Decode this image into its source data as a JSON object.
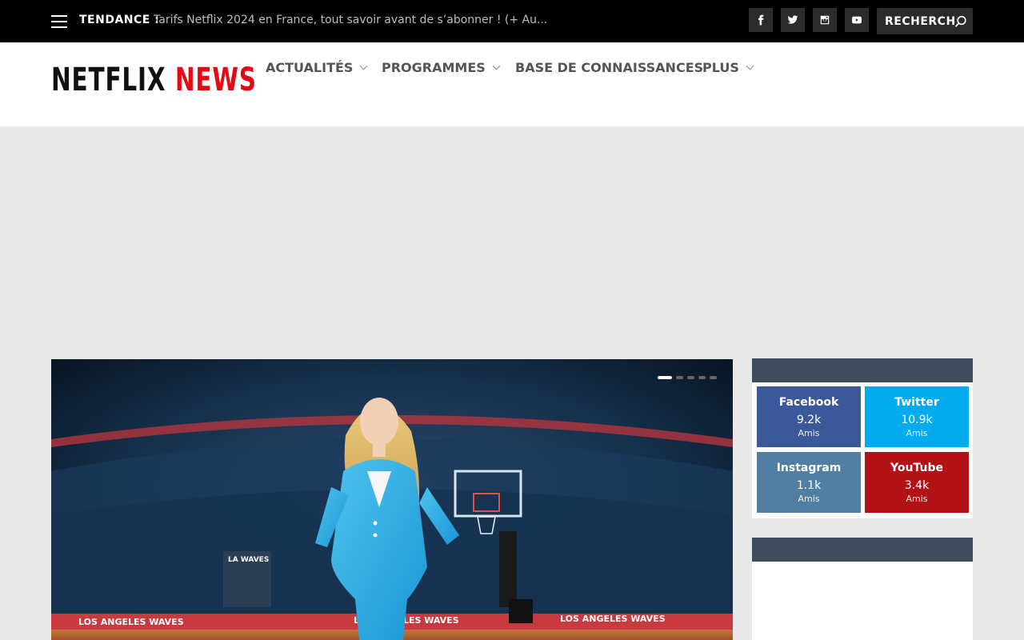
{
  "topbar": {
    "trending_label": "TENDANCE :",
    "trending_text": "Tarifs Netflix 2024 en France, tout savoir avant de s’abonner ! (+ Au...",
    "social_icons": [
      "facebook-icon",
      "twitter-icon",
      "instagram-icon",
      "youtube-icon"
    ],
    "search_placeholder": "RECHERCHE"
  },
  "header": {
    "logo_part1": "NETFLIX",
    "logo_part2": "NEWS",
    "nav": [
      {
        "label": "ACTUALITÉS",
        "has_dropdown": true
      },
      {
        "label": "PROGRAMMES",
        "has_dropdown": true
      },
      {
        "label": "BASE DE CONNAISSANCES",
        "has_dropdown": false
      },
      {
        "label": "PLUS",
        "has_dropdown": true
      }
    ]
  },
  "hero": {
    "slide_count": 5,
    "active_slide": 1,
    "banners": [
      "LOS ANGELES WAVES",
      "LOS ANGELES WAVES",
      "LOS ANGELES WAVES"
    ],
    "sign": "LA WAVES"
  },
  "social_counter": [
    {
      "name": "Facebook",
      "count": "9.2k",
      "unit": "Amis",
      "color": "#3b5998"
    },
    {
      "name": "Twitter",
      "count": "10.9k",
      "unit": "Amis",
      "color": "#00aced"
    },
    {
      "name": "Instagram",
      "count": "1.1k",
      "unit": "Amis",
      "color": "#517fa4"
    },
    {
      "name": "YouTube",
      "count": "3.4k",
      "unit": "Amis",
      "color": "#b31217"
    }
  ],
  "colors": {
    "brand_red": "#e50914",
    "topbar_bg": "#000000",
    "widget_head": "#3e4b5c"
  }
}
